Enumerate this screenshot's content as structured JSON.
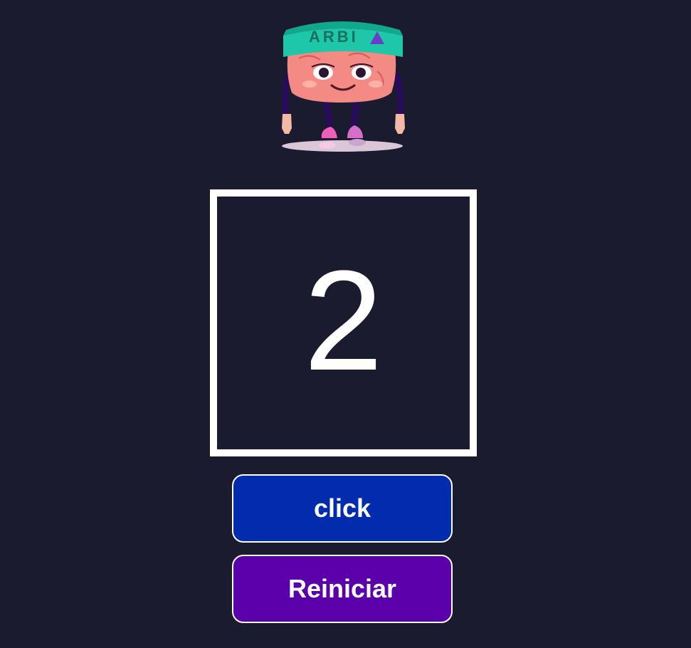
{
  "mascot": {
    "headband_text": "ARBI",
    "icon": "brain-mascot-icon"
  },
  "counter": {
    "value": "2"
  },
  "buttons": {
    "click_label": "click",
    "reset_label": "Reiniciar"
  },
  "colors": {
    "background": "#1b1b2f",
    "click_button": "#002cad",
    "reset_button": "#5a00aa",
    "border": "#ffffff"
  }
}
